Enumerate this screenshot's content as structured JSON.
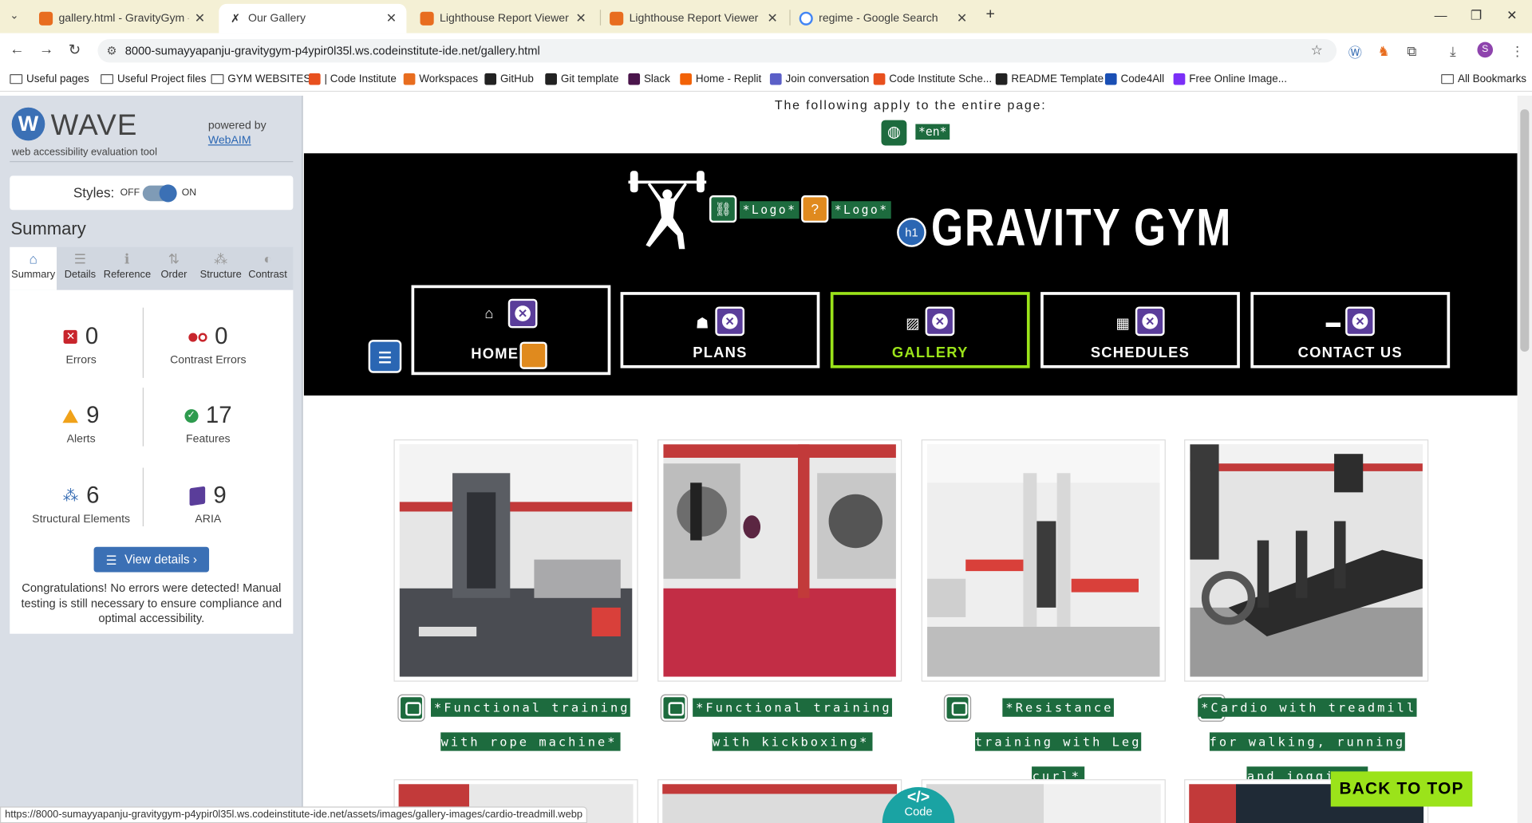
{
  "browser": {
    "tabs": [
      {
        "title": "gallery.html - GravityGym - Git",
        "fav": "#e86d1f"
      },
      {
        "title": "Our Gallery",
        "fav": "#555555"
      },
      {
        "title": "Lighthouse Report Viewer",
        "fav": "#e86d1f"
      },
      {
        "title": "Lighthouse Report Viewer",
        "fav": "#e86d1f"
      },
      {
        "title": "regime - Google Search",
        "fav": "#4285f4"
      }
    ],
    "url": "8000-sumayyapanju-gravitygym-p4ypir0l35l.ws.codeinstitute-ide.net/gallery.html",
    "bookmarks": [
      {
        "label": "Useful pages",
        "icon": "folder"
      },
      {
        "label": "Useful Project files",
        "icon": "folder"
      },
      {
        "label": "GYM WEBSITES",
        "icon": "folder"
      },
      {
        "label": "| Code Institute",
        "icon": "#e8501e"
      },
      {
        "label": "Workspaces",
        "icon": "#e86d1f"
      },
      {
        "label": "GitHub",
        "icon": "#222222"
      },
      {
        "label": "Git template",
        "icon": "#222222"
      },
      {
        "label": "Slack",
        "icon": "#4a154b"
      },
      {
        "label": "Home - Replit",
        "icon": "#f26207"
      },
      {
        "label": "Join conversation",
        "icon": "#5b5fc7"
      },
      {
        "label": "Code Institute Sche...",
        "icon": "#e8501e"
      },
      {
        "label": "README Template",
        "icon": "#222222"
      },
      {
        "label": "Code4All",
        "icon": "#1a4fb4"
      },
      {
        "label": "Free Online Image...",
        "icon": "#7b2ff7"
      }
    ],
    "all_bookmarks": "All Bookmarks",
    "status_url": "https://8000-sumayyapanju-gravitygym-p4ypir0l35l.ws.codeinstitute-ide.net/assets/images/gallery-images/cardio-treadmill.webp"
  },
  "wave": {
    "title": "WAVE",
    "subtitle": "web accessibility evaluation tool",
    "powered_by": "powered by",
    "webaim": "WebAIM",
    "styles_label": "Styles:",
    "off": "OFF",
    "on": "ON",
    "summary": "Summary",
    "tabs": [
      "Summary",
      "Details",
      "Reference",
      "Order",
      "Structure",
      "Contrast"
    ],
    "stats": {
      "errors": {
        "value": "0",
        "label": "Errors"
      },
      "contrast": {
        "value": "0",
        "label": "Contrast Errors"
      },
      "alerts": {
        "value": "9",
        "label": "Alerts"
      },
      "features": {
        "value": "17",
        "label": "Features"
      },
      "structural": {
        "value": "6",
        "label": "Structural Elements"
      },
      "aria": {
        "value": "9",
        "label": "ARIA"
      }
    },
    "view_details": "View details ›",
    "congrats": "Congratulations! No errors were detected! Manual testing is still necessary to ensure compliance and optimal accessibility."
  },
  "page": {
    "applies": "The following apply to the entire page:",
    "lang": "*en*",
    "logo_tag": "*Logo*",
    "brand": "GRAVITY GYM",
    "h1": "h1",
    "nav": [
      {
        "label": "HOME",
        "icon": "home-icon"
      },
      {
        "label": "PLANS",
        "icon": "user-icon"
      },
      {
        "label": "GALLERY",
        "icon": "image-icon"
      },
      {
        "label": "SCHEDULES",
        "icon": "calendar-icon"
      },
      {
        "label": "CONTACT US",
        "icon": "comment-icon"
      }
    ],
    "captions": [
      "*Functional training with rope machine*",
      "*Functional training with kickboxing*",
      "*Resistance training with Leg curl*",
      "*Cardio with treadmill for walking, running and jogging*"
    ],
    "back_to_top": "BACK TO TOP",
    "code_btn": "Code"
  }
}
